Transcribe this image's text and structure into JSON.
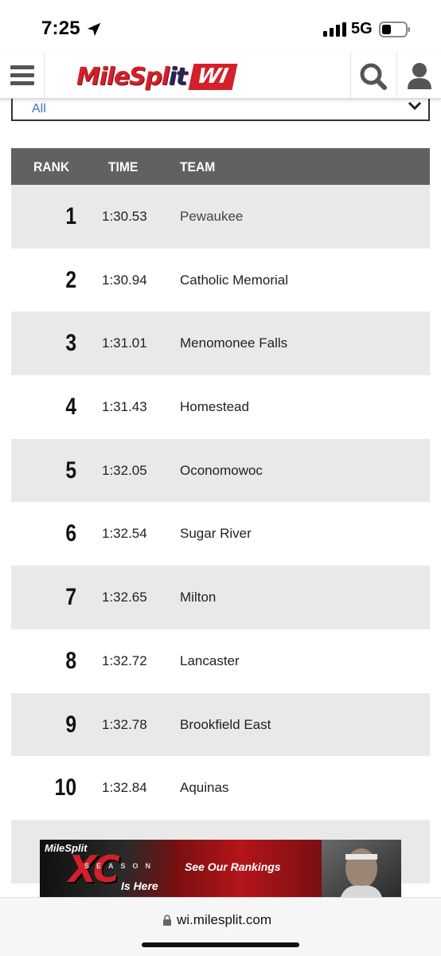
{
  "status_bar": {
    "time": "7:25",
    "network": "5G",
    "icons": [
      "location-arrow-icon",
      "signal-bars-icon",
      "battery-icon"
    ]
  },
  "header": {
    "logo": {
      "main": "MileSpl",
      "split_part": "it",
      "region": "WI"
    },
    "icons": [
      "hamburger-menu-icon",
      "search-icon",
      "user-icon"
    ],
    "brand_color": "#d3202a",
    "brand_dark": "#1c2a5c"
  },
  "filter": {
    "selected": "All"
  },
  "table": {
    "headers": {
      "rank": "RANK",
      "time": "TIME",
      "team": "TEAM"
    },
    "rows": [
      {
        "rank": "1",
        "time": "1:30.53",
        "team": "Pewaukee"
      },
      {
        "rank": "2",
        "time": "1:30.94",
        "team": "Catholic Memorial"
      },
      {
        "rank": "3",
        "time": "1:31.01",
        "team": "Menomonee Falls"
      },
      {
        "rank": "4",
        "time": "1:31.43",
        "team": "Homestead"
      },
      {
        "rank": "5",
        "time": "1:32.05",
        "team": "Oconomowoc"
      },
      {
        "rank": "6",
        "time": "1:32.54",
        "team": "Sugar River"
      },
      {
        "rank": "7",
        "time": "1:32.65",
        "team": "Milton"
      },
      {
        "rank": "8",
        "time": "1:32.72",
        "team": "Lancaster"
      },
      {
        "rank": "9",
        "time": "1:32.78",
        "team": "Brookfield East"
      },
      {
        "rank": "10",
        "time": "1:32.84",
        "team": "Aquinas"
      },
      {
        "rank": "",
        "time": "",
        "team": ""
      }
    ]
  },
  "ad": {
    "brand": "MileSplit",
    "big": "XC",
    "season": "SEASON",
    "tagline": "Is Here",
    "cta": "See Our Rankings"
  },
  "browser": {
    "url": "wi.milesplit.com"
  }
}
